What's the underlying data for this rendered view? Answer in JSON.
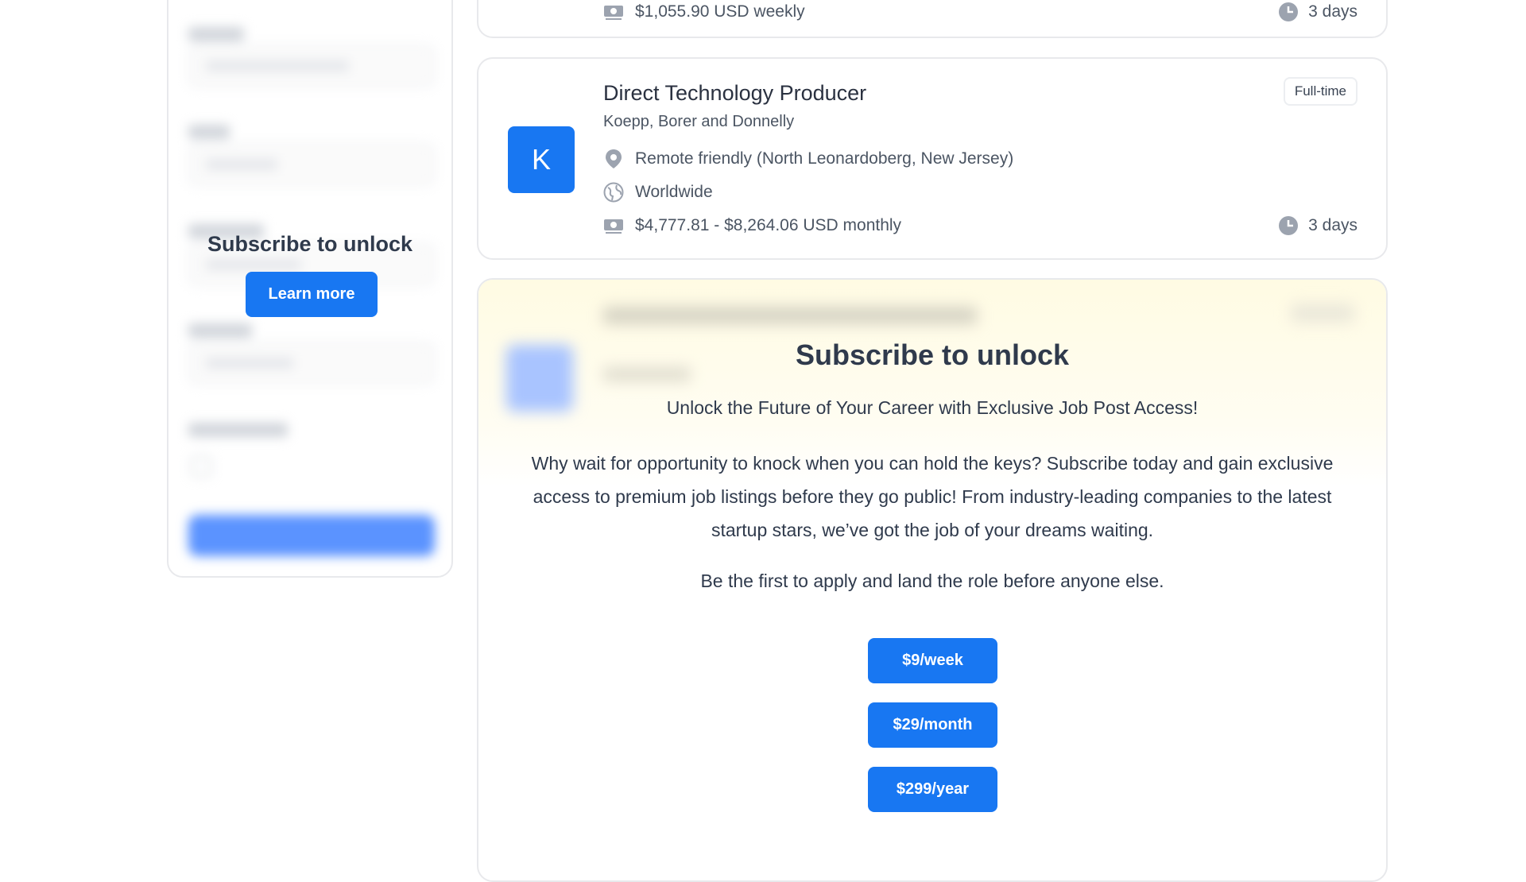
{
  "sidebar": {
    "overlay_title": "Subscribe to unlock",
    "learn_more_label": "Learn more"
  },
  "jobs": [
    {
      "salary": "$1,055.90 USD weekly",
      "posted": "3 days"
    },
    {
      "title": "Direct Technology Producer",
      "company": "Koepp, Borer and Donnelly",
      "logo_letter": "K",
      "badge": "Full-time",
      "location": "Remote friendly (North Leonardoberg, New Jersey)",
      "region": "Worldwide",
      "salary": "$4,777.81 - $8,264.06 USD monthly",
      "posted": "3 days"
    }
  ],
  "locked": {
    "title": "Subscribe to unlock",
    "subtitle": "Unlock the Future of Your Career with Exclusive Job Post Access!",
    "body": "Why wait for opportunity to knock when you can hold the keys? Subscribe today and gain exclusive access to premium job listings before they go public! From industry-leading companies to the latest startup stars, we’ve got the job of your dreams waiting.",
    "note": "Be the first to apply and land the role before anyone else.",
    "plans": [
      "$9/week",
      "$29/month",
      "$299/year"
    ]
  },
  "colors": {
    "accent": "#1877f2",
    "text": "#2f3a4c",
    "muted": "#4b5563",
    "border": "#e8e9ec",
    "locked_bg": "#fffbe3"
  },
  "icons": {
    "location": "map-pin-icon",
    "region": "globe-icon",
    "salary": "money-icon",
    "posted": "clock-icon"
  }
}
